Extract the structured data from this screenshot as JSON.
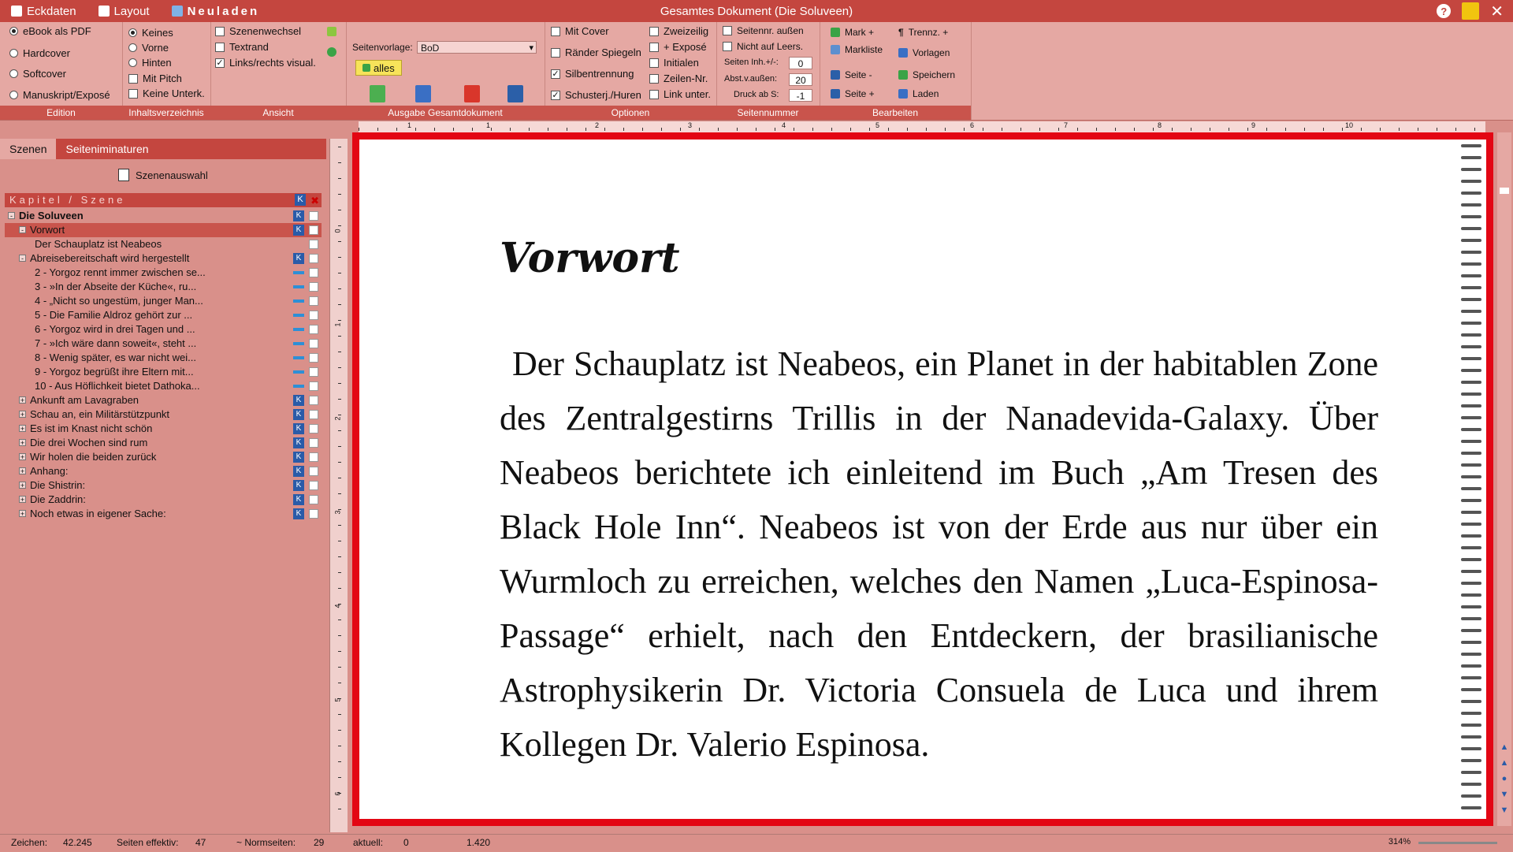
{
  "titlebar": {
    "menu": [
      {
        "label": "Eckdaten",
        "icon": "document-icon"
      },
      {
        "label": "Layout",
        "icon": "layout-icon"
      },
      {
        "label": "Neuladen",
        "icon": "reload-icon"
      }
    ],
    "title": "Gesamtes Dokument  (Die Soluveen)",
    "help": "?",
    "close": "✕"
  },
  "ribbon": {
    "edition": {
      "label": "Edition",
      "options": [
        {
          "label": "eBook als PDF",
          "checked": true
        },
        {
          "label": "Hardcover",
          "checked": false
        },
        {
          "label": "Softcover",
          "checked": false
        },
        {
          "label": "Manuskript/Exposé",
          "checked": false
        }
      ]
    },
    "inhaltsverzeichnis": {
      "label": "Inhaltsverzeichnis",
      "radios": [
        {
          "label": "Keines",
          "checked": true
        },
        {
          "label": "Vorne",
          "checked": false
        },
        {
          "label": "Hinten",
          "checked": false
        }
      ],
      "checks": [
        {
          "label": "Mit Pitch",
          "checked": false
        },
        {
          "label": "Keine Unterk.",
          "checked": false
        }
      ]
    },
    "ansicht": {
      "label": "Ansicht",
      "checks": [
        {
          "label": "Szenenwechsel",
          "checked": false
        },
        {
          "label": "Textrand",
          "checked": false
        },
        {
          "label": "Links/rechts visual.",
          "checked": true
        }
      ]
    },
    "ausgabe": {
      "label": "Ausgabe Gesamtdokument",
      "seitenvorlage_label": "Seitenvorlage:",
      "seitenvorlage_value": "BoD",
      "alles_button": "alles"
    },
    "optionen": {
      "label": "Optionen",
      "col1": [
        {
          "label": "Mit Cover",
          "checked": false
        },
        {
          "label": "Ränder Spiegeln",
          "checked": false
        },
        {
          "label": "Silbentrennung",
          "checked": true
        },
        {
          "label": "Schusterj./Huren",
          "checked": true
        }
      ],
      "col2": [
        {
          "label": "Zweizeilig",
          "checked": false
        },
        {
          "label": "+ Exposé",
          "checked": false
        },
        {
          "label": "Initialen",
          "checked": false
        },
        {
          "label": "Zeilen-Nr.",
          "checked": false
        },
        {
          "label": "Link unter.",
          "checked": false
        }
      ]
    },
    "seitennummer": {
      "label": "Seitennummer",
      "checks": [
        {
          "label": "Seitennr. außen",
          "checked": false
        },
        {
          "label": "Nicht auf Leers.",
          "checked": false
        }
      ],
      "fields": [
        {
          "label": "Seiten Inh.+/-:",
          "value": "0"
        },
        {
          "label": "Abst.v.außen:",
          "value": "20"
        },
        {
          "label": "Druck ab S:",
          "value": "-1"
        }
      ]
    },
    "bearbeiten": {
      "label": "Bearbeiten",
      "col1": [
        "Mark +",
        "Markliste",
        "Seite -",
        "Seite +"
      ],
      "col2": [
        "Trennz. +",
        "Vorlagen",
        "Speichern",
        "Laden"
      ]
    }
  },
  "leftpanel": {
    "tabs": [
      "Szenen",
      "Seiteniminaturen"
    ],
    "szenenauswahl": "Szenenauswahl",
    "tree_header": "Kapitel / Szene",
    "tree": [
      {
        "label": "Die Soluveen",
        "level": 0,
        "exp": "-",
        "bold": true,
        "mark": "k"
      },
      {
        "label": "Vorwort",
        "level": 1,
        "exp": "-",
        "hl": true,
        "mark": "k"
      },
      {
        "label": "Der Schauplatz ist Neabeos",
        "level": 2,
        "exp": "",
        "mark": "none"
      },
      {
        "label": "Abreisebereitschaft wird hergestellt",
        "level": 1,
        "exp": "-",
        "mark": "k"
      },
      {
        "label": "2 - Yorgoz rennt immer zwischen se...",
        "level": 2,
        "exp": "",
        "mark": "bar"
      },
      {
        "label": "3 - »In der Abseite der Küche«, ru...",
        "level": 2,
        "exp": "",
        "mark": "bar"
      },
      {
        "label": "4 - „Nicht so ungestüm, junger Man...",
        "level": 2,
        "exp": "",
        "mark": "bar"
      },
      {
        "label": "5 - Die Familie Aldroz gehört zur ...",
        "level": 2,
        "exp": "",
        "mark": "bar"
      },
      {
        "label": "6 - Yorgoz wird in drei Tagen und ...",
        "level": 2,
        "exp": "",
        "mark": "bar"
      },
      {
        "label": "7 - »Ich wäre dann soweit«, steht ...",
        "level": 2,
        "exp": "",
        "mark": "bar"
      },
      {
        "label": "8 - Wenig später, es war nicht wei...",
        "level": 2,
        "exp": "",
        "mark": "bar"
      },
      {
        "label": "9 - Yorgoz begrüßt ihre Eltern mit...",
        "level": 2,
        "exp": "",
        "mark": "bar"
      },
      {
        "label": "10 - Aus Höflichkeit bietet Dathoka...",
        "level": 2,
        "exp": "",
        "mark": "bar"
      },
      {
        "label": "Ankunft am Lavagraben",
        "level": 1,
        "exp": "+",
        "mark": "k"
      },
      {
        "label": "Schau an, ein Militärstützpunkt",
        "level": 1,
        "exp": "+",
        "mark": "k"
      },
      {
        "label": "Es ist im Knast nicht schön",
        "level": 1,
        "exp": "+",
        "mark": "k"
      },
      {
        "label": "Die drei Wochen sind rum",
        "level": 1,
        "exp": "+",
        "mark": "k"
      },
      {
        "label": "Wir holen die beiden zurück",
        "level": 1,
        "exp": "+",
        "mark": "k"
      },
      {
        "label": "Anhang:",
        "level": 1,
        "exp": "+",
        "mark": "k"
      },
      {
        "label": "Die Shistrin:",
        "level": 1,
        "exp": "+",
        "mark": "k"
      },
      {
        "label": "Die Zaddrin:",
        "level": 1,
        "exp": "+",
        "mark": "k"
      },
      {
        "label": "Noch etwas in eigener Sache:",
        "level": 1,
        "exp": "+",
        "mark": "k"
      }
    ]
  },
  "hruler_labels": [
    "1",
    "1",
    "2",
    "3",
    "4",
    "5",
    "6",
    "7",
    "8",
    "9",
    "10"
  ],
  "vruler_labels": [
    "0",
    "1",
    "2",
    "3",
    "4",
    "5",
    "6"
  ],
  "document": {
    "heading": "Vorwort",
    "paragraph": "Der Schauplatz ist Neabeos, ein Planet in der habitablen Zone des Zentralgestirns Trillis in der Nanadevida-Galaxy. Über Neabeos berichtete ich einleitend im Buch „Am Tresen des Black Hole Inn“. Neabeos ist von der Erde aus nur über ein Wurmloch zu erreichen, welches den Namen „Luca-Espinosa-Passage“ erhielt, nach den Entdeckern, der brasilianische Astrophysikerin Dr. Victoria Consuela de Luca und ihrem Kollegen Dr. Valerio Espinosa."
  },
  "statusbar": {
    "zeichen_label": "Zeichen:",
    "zeichen_value": "42.245",
    "seiten_label": "Seiten effektiv:",
    "seiten_value": "47",
    "norm_label": "~ Normseiten:",
    "norm_value": "29",
    "aktuell_label": "aktuell:",
    "aktuell_value": "0",
    "pos_value": "1.420",
    "zoom": "314%"
  },
  "colors": {
    "titlebar": "#c4463f",
    "ribbon": "#e5a8a3",
    "page_border": "#e30613",
    "k_mark": "#2a5ba8",
    "bar_mark": "#2e8fd6"
  }
}
